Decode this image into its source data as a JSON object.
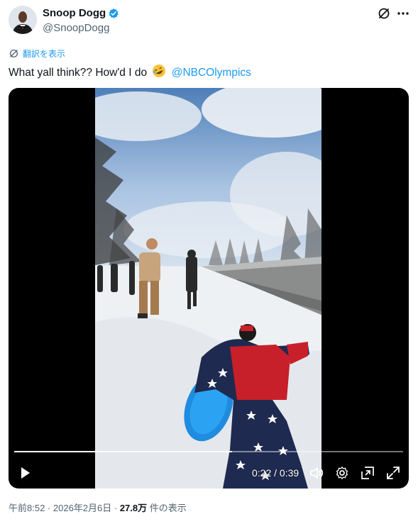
{
  "author": {
    "display_name": "Snoop Dogg",
    "handle": "@SnoopDogg",
    "verified_color": "#1d9bf0"
  },
  "translate_label": "翻訳を表示",
  "tweet": {
    "text_before_emoji": "What yall think?? How'd I do",
    "emoji_icon": "rofl-emoji",
    "mention": "@NBCOlympics"
  },
  "video": {
    "current_time": "0:22",
    "duration": "0:39",
    "time_separator": " / ",
    "progress_fraction": 0.56
  },
  "meta": {
    "time": "午前8:52",
    "date": "2026年2月6日",
    "separator": " · ",
    "views_count": "27.8万",
    "views_label": " 件の表示"
  },
  "colors": {
    "link": "#1d9bf0",
    "secondary_text": "#536471",
    "video_background": "#000000"
  }
}
